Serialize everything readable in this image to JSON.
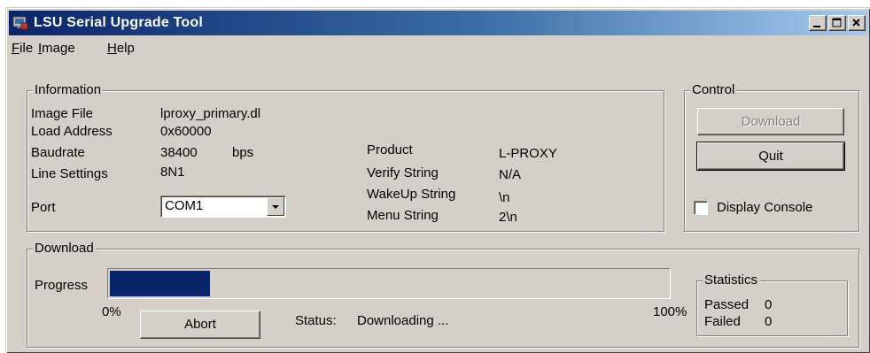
{
  "window": {
    "title": "LSU Serial Upgrade Tool",
    "title_bar_color": "#0a246a"
  },
  "menu": {
    "items": [
      {
        "label": "File",
        "mnemonic": "F",
        "rest": "ile"
      },
      {
        "label": "Image",
        "mnemonic": "I",
        "rest": "mage"
      },
      {
        "label": "Help",
        "mnemonic": "H",
        "rest": "elp"
      }
    ]
  },
  "information": {
    "group_label": "Information",
    "image_file": {
      "label": "Image File",
      "value": "lproxy_primary.dl"
    },
    "load_address": {
      "label": "Load Address",
      "value": "0x60000"
    },
    "baudrate": {
      "label": "Baudrate",
      "value": "38400",
      "unit": "bps"
    },
    "line_settings": {
      "label": "Line Settings",
      "value": "8N1"
    },
    "port": {
      "label": "Port",
      "value": "COM1"
    },
    "product": {
      "label": "Product",
      "value": "L-PROXY"
    },
    "verify_string": {
      "label": "Verify String",
      "value": "N/A"
    },
    "wakeup_string": {
      "label": "WakeUp String",
      "value": "\\n"
    },
    "menu_string": {
      "label": "Menu String",
      "value": "2\\n"
    }
  },
  "control": {
    "group_label": "Control",
    "download_button": "Download",
    "quit_button": "Quit",
    "display_console": {
      "label": "Display Console",
      "checked": false
    }
  },
  "download": {
    "group_label": "Download",
    "progress_label": "Progress",
    "progress_fraction": 0.18,
    "progress_color": "#0a246a",
    "min_label": "0%",
    "max_label": "100%",
    "abort_button": "Abort",
    "status_label": "Status:",
    "status_value": "Downloading ..."
  },
  "statistics": {
    "group_label": "Statistics",
    "passed_label": "Passed",
    "passed_value": "0",
    "failed_label": "Failed",
    "failed_value": "0"
  },
  "icons": [
    "app-icon",
    "minimize-icon",
    "maximize-icon",
    "close-icon",
    "dropdown-arrow-icon"
  ]
}
